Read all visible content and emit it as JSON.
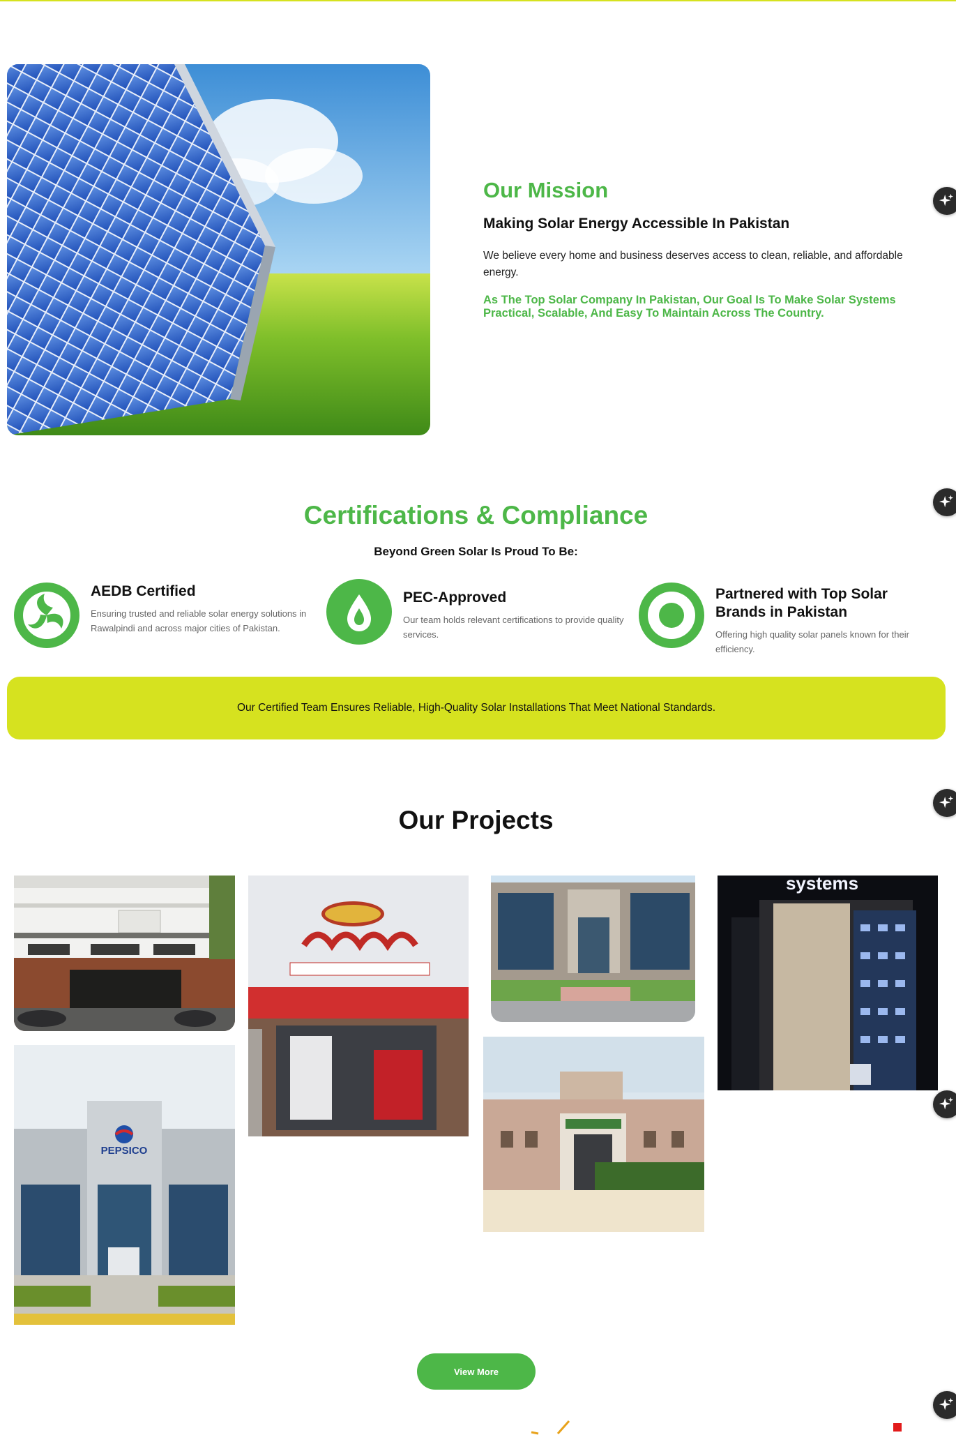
{
  "mission": {
    "title": "Our Mission",
    "subtitle": "Making Solar Energy Accessible In Pakistan",
    "body": "We believe every home and business deserves access to clean, reliable, and affordable energy.",
    "highlight": "As The Top Solar Company In Pakistan, Our Goal Is To Make Solar Systems Practical, Scalable, And Easy To Maintain Across The Country."
  },
  "certifications": {
    "title": "Certifications & Compliance",
    "subtitle": "Beyond Green Solar Is Proud To Be:",
    "items": [
      {
        "heading": "AEDB Certified",
        "text": "Ensuring trusted and reliable solar energy solutions in Rawalpindi and across major cities of Pakistan.",
        "icon": "aedb-swirl-icon"
      },
      {
        "heading": "PEC-Approved",
        "text": "Our team holds relevant certifications to provide quality services.",
        "icon": "drop-icon"
      },
      {
        "heading": "Partnered with Top Solar Brands in Pakistan",
        "text": "Offering high quality solar panels known for their efficiency.",
        "icon": "target-icon"
      }
    ],
    "banner": "Our Certified Team Ensures Reliable, High-Quality Solar Installations That Meet National Standards."
  },
  "projects": {
    "title": "Our Projects",
    "signs": {
      "pepsico": "PEPSICO",
      "systems": "systems"
    },
    "view_more": "View More"
  },
  "colors": {
    "brand_green": "#4db748",
    "accent_lime": "#d6e21f"
  },
  "icons": [
    "sparkle-icon"
  ]
}
